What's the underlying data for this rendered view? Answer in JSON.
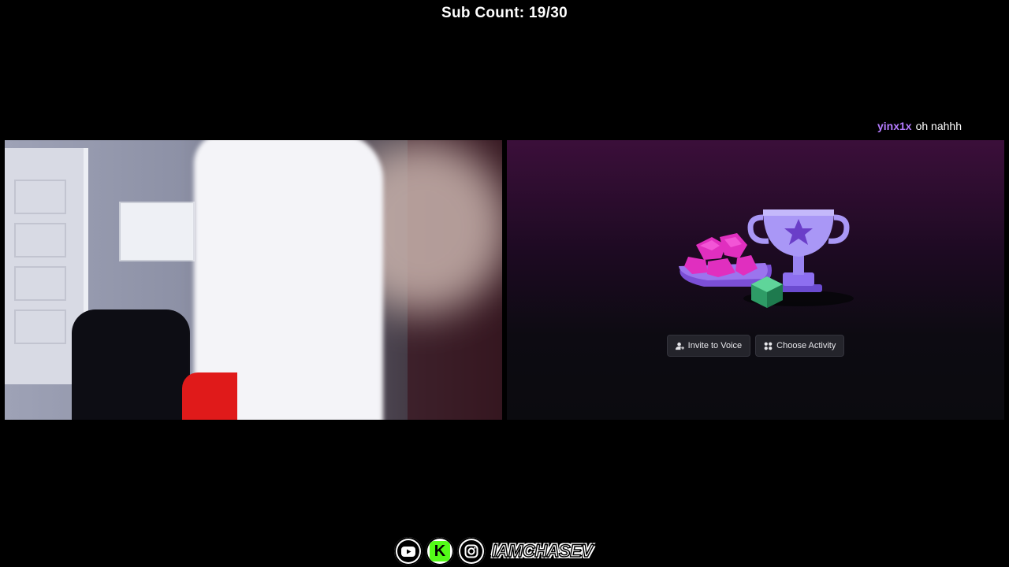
{
  "overlay": {
    "sub_count": "Sub Count: 19/30"
  },
  "chat": {
    "username": "yinx1x",
    "message": "oh nahhh",
    "username_color": "#b57cff"
  },
  "discord_activity": {
    "invite_label": "Invite to Voice",
    "choose_activity_label": "Choose Activity",
    "invite_icon": "user-plus-icon",
    "activity_icon": "grid-icon",
    "art": "trophy-gems-dice-icon"
  },
  "socials": {
    "icons": [
      "youtube-icon",
      "kick-icon",
      "instagram-icon"
    ],
    "kick_letter": "K",
    "handle": "IAMCHASEV",
    "kick_color": "#53fc18"
  }
}
